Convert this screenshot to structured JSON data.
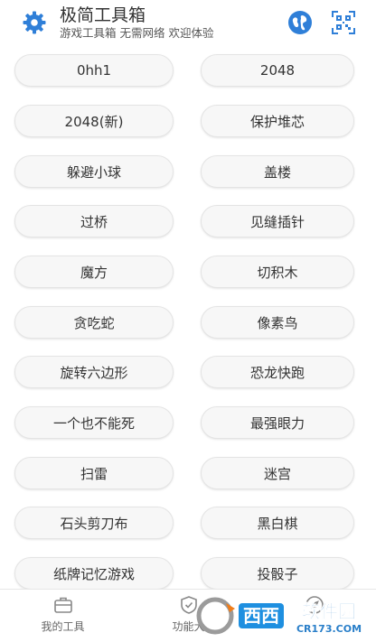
{
  "header": {
    "title": "极简工具箱",
    "subtitle": "游戏工具箱 无需网络 欢迎体验",
    "icons": [
      "gear-icon",
      "globe-icon",
      "qr-scan-icon"
    ],
    "accent_color": "#2f7fd8"
  },
  "games": [
    [
      "0hh1",
      "2048"
    ],
    [
      "2048(新)",
      "保护堆芯"
    ],
    [
      "躲避小球",
      "盖楼"
    ],
    [
      "过桥",
      "见缝插针"
    ],
    [
      "魔方",
      "切积木"
    ],
    [
      "贪吃蛇",
      "像素鸟"
    ],
    [
      "旋转六边形",
      "恐龙快跑"
    ],
    [
      "一个也不能死",
      "最强眼力"
    ],
    [
      "扫雷",
      "迷宫"
    ],
    [
      "石头剪刀布",
      "黑白棋"
    ],
    [
      "纸牌记忆游戏",
      "投骰子"
    ]
  ],
  "tabs": [
    {
      "label": "我的工具",
      "icon": "toolbox-icon"
    },
    {
      "label": "功能大",
      "icon": "shield-icon"
    },
    {
      "label": "",
      "icon": "compass-icon"
    }
  ],
  "watermark": {
    "brand": "西西",
    "site": "软件园",
    "url": "CR173.COM",
    "icon": "cr-logo-icon"
  }
}
